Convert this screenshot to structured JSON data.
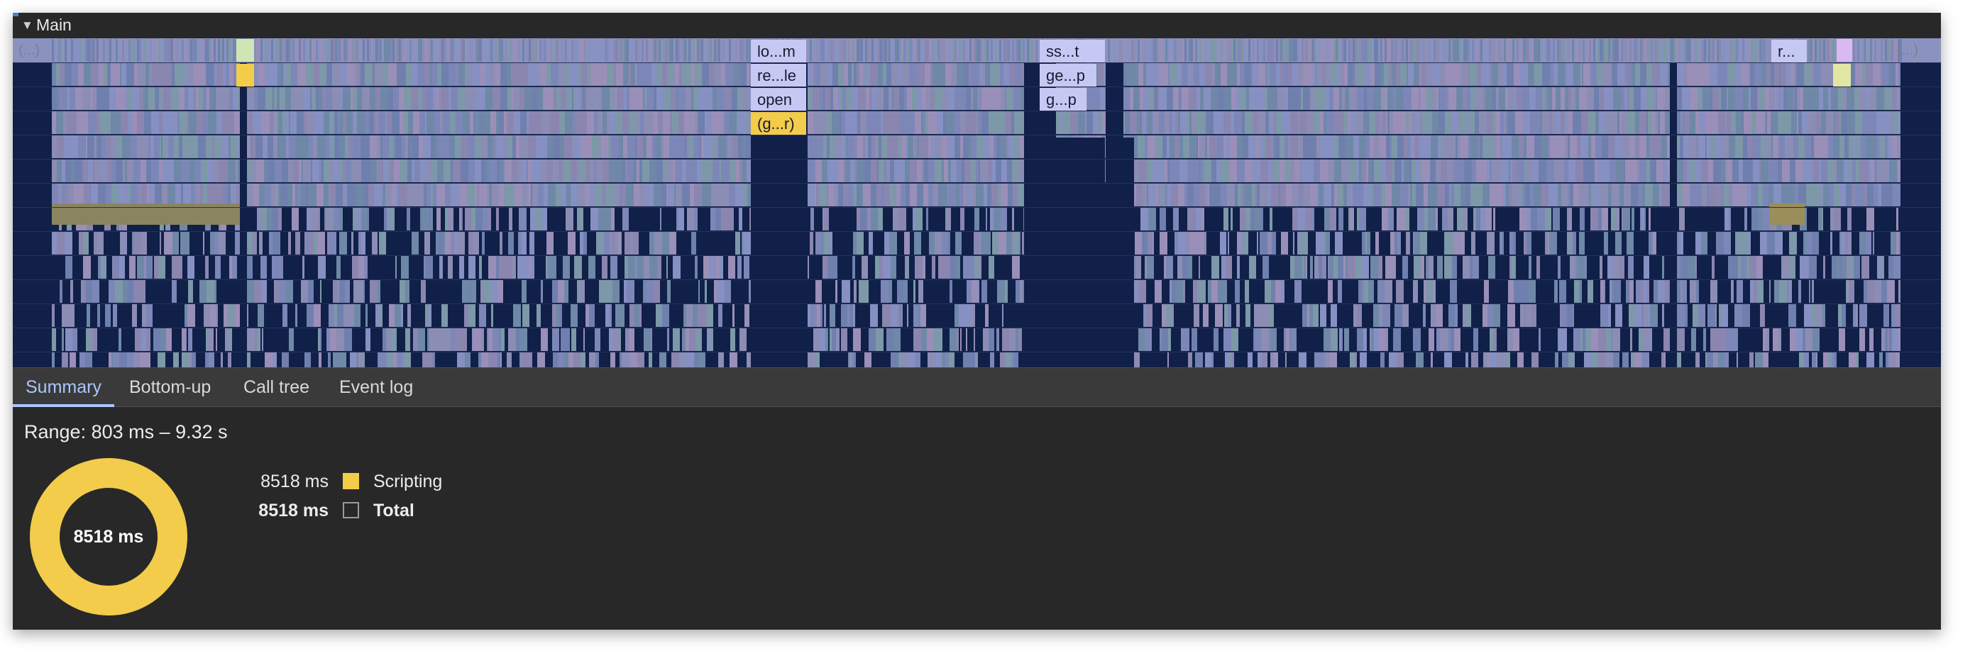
{
  "track": {
    "collapse_glyph": "▼",
    "title": "Main"
  },
  "flame_labels": {
    "ellipsis_left": "(...)",
    "ellipsis_right": "(...)",
    "col1": [
      "lo...m",
      "re...le",
      "open",
      "(g...r)"
    ],
    "col2": [
      "ss...t",
      "ge...p",
      "g...p"
    ],
    "col3": [
      "r..."
    ]
  },
  "tabs": [
    {
      "label": "Summary",
      "active": true
    },
    {
      "label": "Bottom-up",
      "active": false
    },
    {
      "label": "Call tree",
      "active": false
    },
    {
      "label": "Event log",
      "active": false
    }
  ],
  "summary": {
    "range": "Range: 803 ms – 9.32 s",
    "donut_total": "8518 ms",
    "rows": [
      {
        "value": "8518 ms",
        "label": "Scripting",
        "color": "#f2cc4a"
      },
      {
        "value": "8518 ms",
        "label": "Total",
        "color": ""
      }
    ]
  },
  "colors": {
    "flame_base": "#7c87b8",
    "flame_dark": "#102048",
    "flame_label_bg": "#c6c8f4",
    "scripting": "#f2cc4a",
    "accent_tab": "#a9c7ff"
  }
}
